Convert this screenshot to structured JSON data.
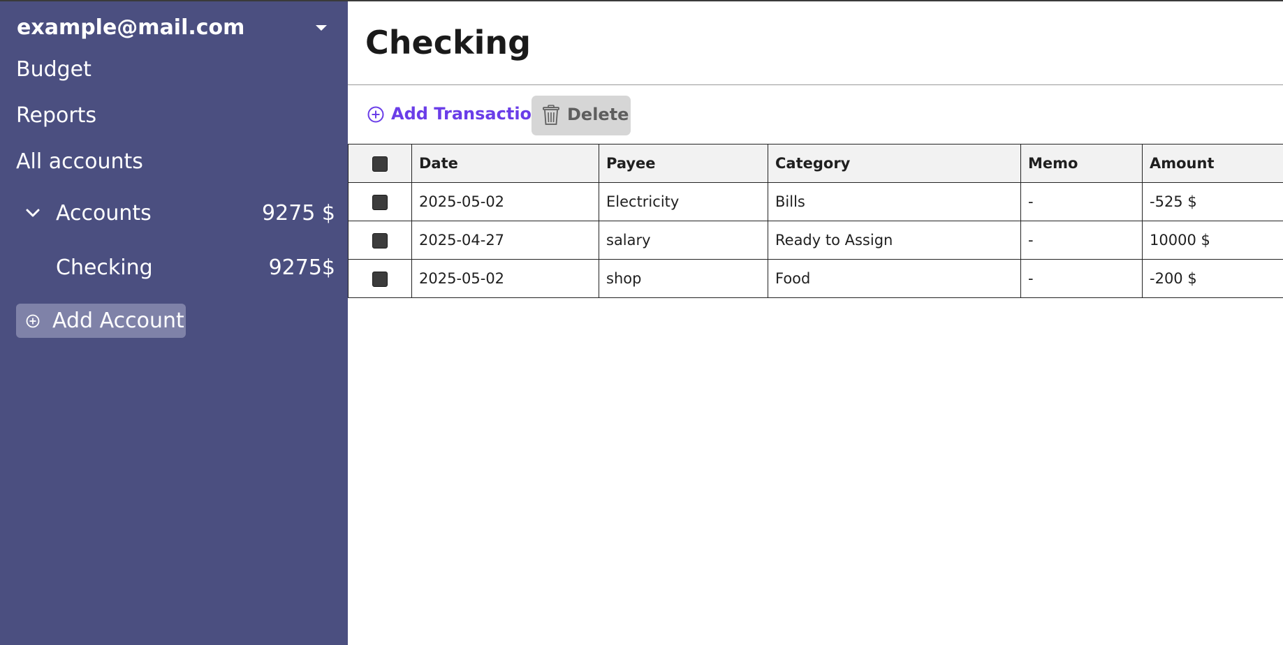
{
  "sidebar": {
    "user_email": "example@mail.com",
    "nav": [
      "Budget",
      "Reports",
      "All accounts"
    ],
    "account_group": {
      "label": "Accounts",
      "total": "9275 $"
    },
    "accounts": [
      {
        "name": "Checking",
        "balance": "9275$"
      }
    ],
    "add_account_label": "Add Account"
  },
  "main": {
    "title": "Checking",
    "toolbar": {
      "add_transaction_label": "Add Transaction",
      "delete_label": "Delete"
    },
    "table": {
      "headers": [
        "Date",
        "Payee",
        "Category",
        "Memo",
        "Amount"
      ],
      "rows": [
        {
          "date": "2025-05-02",
          "payee": "Electricity",
          "category": "Bills",
          "memo": "-",
          "amount": "-525 $"
        },
        {
          "date": "2025-04-27",
          "payee": "salary",
          "category": "Ready to Assign",
          "memo": "-",
          "amount": "10000 $"
        },
        {
          "date": "2025-05-02",
          "payee": "shop",
          "category": "Food",
          "memo": "-",
          "amount": "-200 $"
        }
      ]
    }
  },
  "colors": {
    "sidebar_bg": "#4b4f80",
    "accent": "#6a3de8",
    "delete_button_bg": "#d6d6d6",
    "add_account_bg": "#7f82a8"
  },
  "icons": [
    "caret-down-icon",
    "chevron-down-icon",
    "plus-circle-icon",
    "trash-icon",
    "checkbox-icon"
  ]
}
